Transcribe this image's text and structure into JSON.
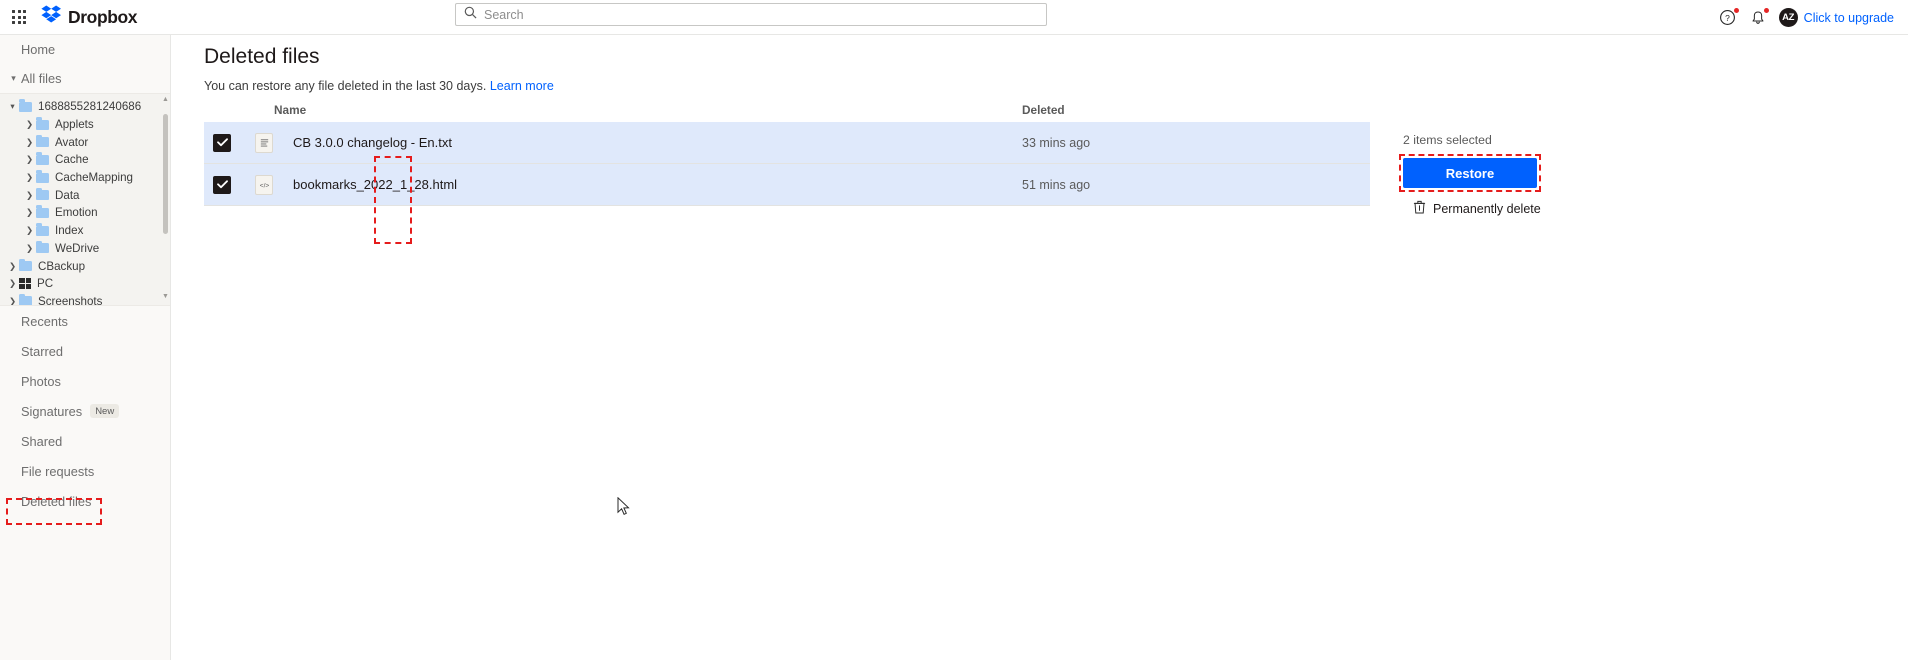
{
  "header": {
    "apps_icon": "grid-apps-icon",
    "brand": "Dropbox",
    "search_placeholder": "Search",
    "search_value": "",
    "help_icon": "help-circle-icon",
    "notifications_icon": "bell-icon",
    "avatar_initials": "AZ",
    "upgrade_link": "Click to upgrade"
  },
  "sidebar": {
    "top_items": [
      {
        "label": "Home",
        "icon": "",
        "expandable": false
      },
      {
        "label": "All files",
        "icon": "chevron-down-icon",
        "expandable": true
      }
    ],
    "tree": [
      {
        "label": "1688855281240686",
        "depth": 0,
        "caret": "chevron-down-icon",
        "icon": "folder-icon"
      },
      {
        "label": "Applets",
        "depth": 1,
        "caret": "chevron-right-icon",
        "icon": "folder-icon"
      },
      {
        "label": "Avator",
        "depth": 1,
        "caret": "chevron-right-icon",
        "icon": "folder-icon"
      },
      {
        "label": "Cache",
        "depth": 1,
        "caret": "chevron-right-icon",
        "icon": "folder-icon"
      },
      {
        "label": "CacheMapping",
        "depth": 1,
        "caret": "chevron-right-icon",
        "icon": "folder-icon"
      },
      {
        "label": "Data",
        "depth": 1,
        "caret": "chevron-right-icon",
        "icon": "folder-icon"
      },
      {
        "label": "Emotion",
        "depth": 1,
        "caret": "chevron-right-icon",
        "icon": "folder-icon"
      },
      {
        "label": "Index",
        "depth": 1,
        "caret": "chevron-right-icon",
        "icon": "folder-icon"
      },
      {
        "label": "WeDrive",
        "depth": 1,
        "caret": "chevron-right-icon",
        "icon": "folder-icon"
      },
      {
        "label": "CBackup",
        "depth": 0,
        "caret": "chevron-right-icon",
        "icon": "folder-icon"
      },
      {
        "label": "PC",
        "depth": 0,
        "caret": "chevron-right-icon",
        "icon": "windows-icon"
      },
      {
        "label": "Screenshots",
        "depth": 0,
        "caret": "chevron-right-icon",
        "icon": "folder-icon"
      }
    ],
    "bottom_items": [
      {
        "label": "Recents",
        "badge": ""
      },
      {
        "label": "Starred",
        "badge": ""
      },
      {
        "label": "Photos",
        "badge": ""
      },
      {
        "label": "Signatures",
        "badge": "New"
      },
      {
        "label": "Shared",
        "badge": ""
      },
      {
        "label": "File requests",
        "badge": ""
      },
      {
        "label": "Deleted files",
        "badge": "",
        "highlighted": true
      }
    ]
  },
  "main": {
    "title": "Deleted files",
    "subtitle": "You can restore any file deleted in the last 30 days.",
    "learn_more": "Learn more",
    "columns": {
      "name": "Name",
      "deleted": "Deleted"
    },
    "rows": [
      {
        "checked": true,
        "icon": "text-file-icon",
        "name": "CB 3.0.0 changelog - En.txt",
        "deleted": "33 mins ago"
      },
      {
        "checked": true,
        "icon": "html-file-icon",
        "name": "bookmarks_2022_1_28.html",
        "deleted": "51 mins ago"
      }
    ]
  },
  "actions": {
    "selected_label": "2 items selected",
    "restore_label": "Restore",
    "permanently_delete_label": "Permanently delete",
    "trash_icon": "trash-icon"
  },
  "colors": {
    "accent_blue": "#0061fe",
    "row_selected": "#dfe9fb",
    "highlight_red": "#e51c1c",
    "sidebar_bg": "#faf9f7"
  }
}
